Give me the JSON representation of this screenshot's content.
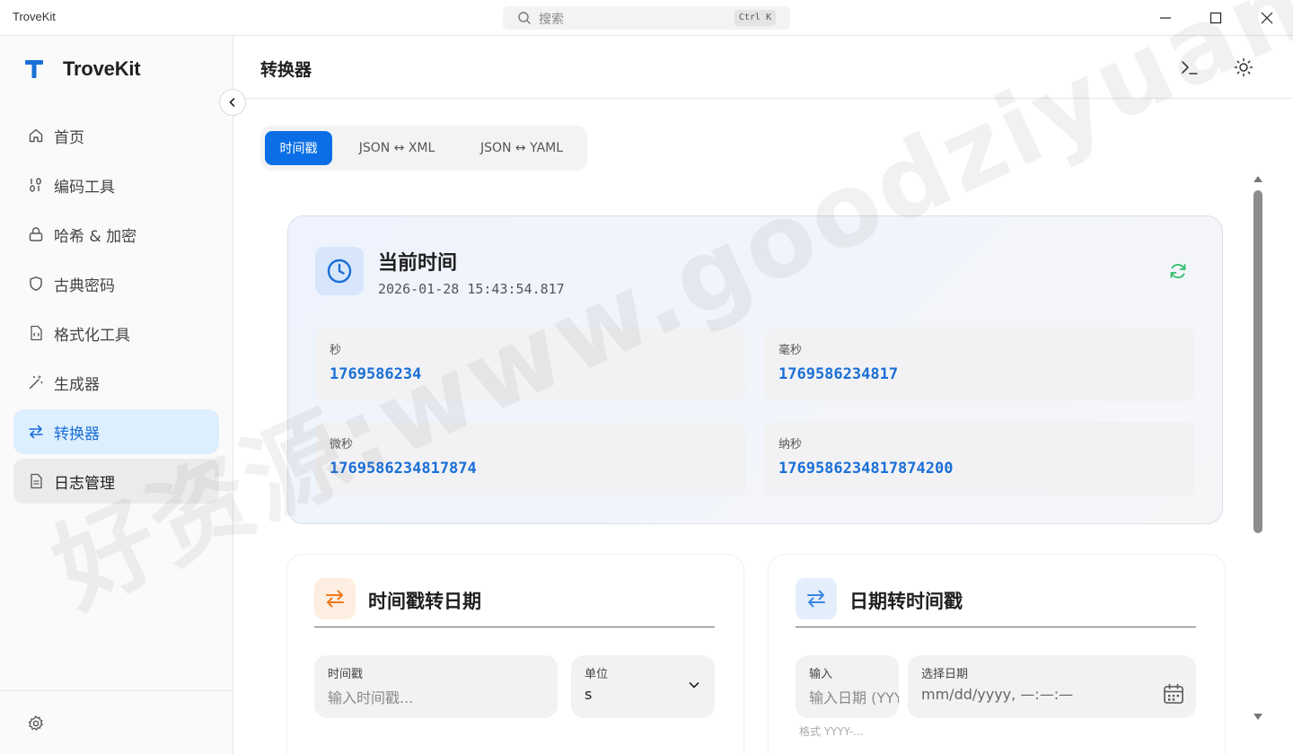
{
  "app": {
    "name": "TroveKit"
  },
  "search": {
    "placeholder": "搜索",
    "shortcut": "Ctrl K"
  },
  "sidebar": {
    "logo_text": "TroveKit",
    "items": [
      {
        "label": "首页",
        "icon": "home-icon"
      },
      {
        "label": "编码工具",
        "icon": "binary-icon"
      },
      {
        "label": "哈希 & 加密",
        "icon": "lock-icon"
      },
      {
        "label": "古典密码",
        "icon": "shield-icon"
      },
      {
        "label": "格式化工具",
        "icon": "file-code-icon"
      },
      {
        "label": "生成器",
        "icon": "magic-wand-icon"
      },
      {
        "label": "转换器",
        "icon": "swap-icon",
        "state": "active"
      },
      {
        "label": "日志管理",
        "icon": "file-text-icon",
        "state": "hover"
      }
    ]
  },
  "page": {
    "title": "转换器"
  },
  "tabs": [
    {
      "label": "时间戳",
      "active": true
    },
    {
      "label": "JSON ↔ XML"
    },
    {
      "label": "JSON ↔ YAML"
    }
  ],
  "current_time": {
    "title": "当前时间",
    "datetime": "2026-01-28 15:43:54.817",
    "seconds_label": "秒",
    "seconds": "1769586234",
    "millis_label": "毫秒",
    "millis": "1769586234817",
    "micros_label": "微秒",
    "micros": "1769586234817874",
    "nanos_label": "纳秒",
    "nanos": "1769586234817874200"
  },
  "ts_to_date": {
    "title": "时间戳转日期",
    "input_label": "时间戳",
    "input_placeholder": "输入时间戳...",
    "unit_label": "单位",
    "unit_value": "s"
  },
  "date_to_ts": {
    "title": "日期转时间戳",
    "input_label": "输入",
    "input_placeholder": "输入日期 (YYYY-MM-DD HH:mm:ss)",
    "picker_label": "选择日期",
    "picker_placeholder": "mm/dd/yyyy, —:—:—",
    "hint": "格式 YYYY-..."
  },
  "watermark": "好资源:www.goodziyuan.com",
  "colors": {
    "accent": "#0a6fe6",
    "active_bg": "#ddeeff",
    "orange": "#f07a1a",
    "green": "#2fbf6a"
  }
}
